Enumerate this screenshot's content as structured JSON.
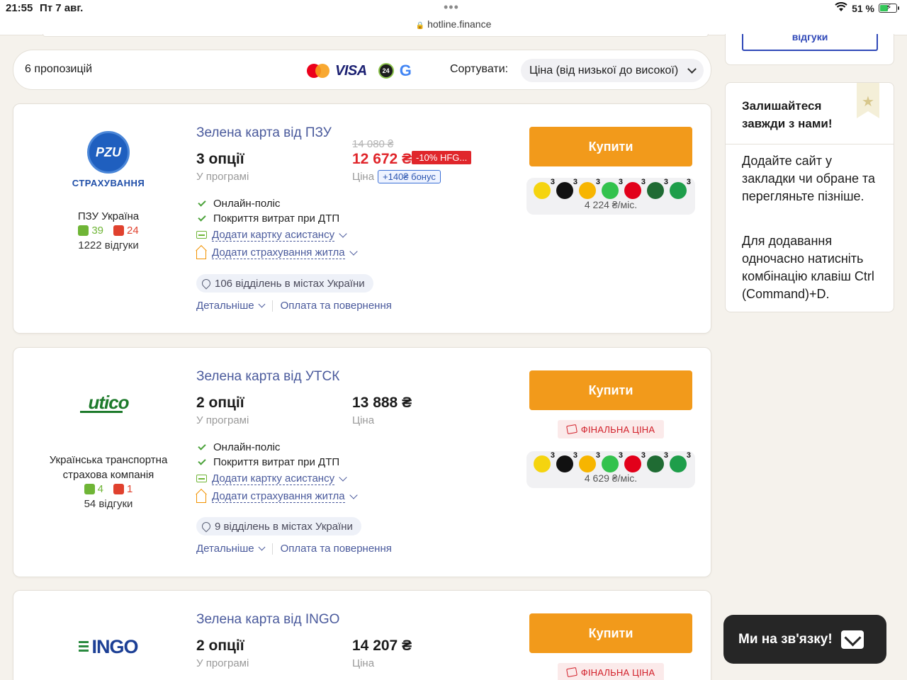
{
  "status_bar": {
    "time": "21:55",
    "date": "Пт 7 авг.",
    "url": "hotline.finance",
    "battery": "51 %"
  },
  "sort_bar": {
    "offers_count": "6 пропозицій",
    "payment_icons": [
      "mastercard-icon",
      "visa-icon",
      "apple-pay-icon",
      "privat24-icon",
      "google-pay-icon"
    ],
    "visa_text": "VISA",
    "p24_text": "24",
    "google_text": "G",
    "sort_label": "Сортувати:",
    "sort_value": "Ціна (від низької до високої)"
  },
  "offers": [
    {
      "title": "Зелена карта від ПЗУ",
      "logo_text": "PZU",
      "logo_caption": "СТРАХУВАННЯ",
      "company": "ПЗУ Україна",
      "likes": "39",
      "dislikes": "24",
      "reviews": "1222 відгуки",
      "options": "3 опції",
      "options_sub": "У програмі",
      "price_old": "14 080 ₴",
      "price": "12 672 ₴",
      "discount": "-10% HFG...",
      "price_sub": "Ціна",
      "bonus": "+140₴ бонус",
      "features": [
        "Онлайн-поліс",
        "Покриття витрат при ДТП"
      ],
      "addons": [
        "Додати картку асистансу",
        "Додати страхування житла"
      ],
      "branches": "106 відділень в містах України",
      "more": "Детальніше",
      "payment_link": "Оплата та повернення",
      "buy": "Купити",
      "installment": "4 224 ₴/міс."
    },
    {
      "title": "Зелена карта від УТСК",
      "logo_text": "utico",
      "company": "Українська транспортна страхова компанія",
      "likes": "4",
      "dislikes": "1",
      "reviews": "54 відгуки",
      "options": "2 опції",
      "options_sub": "У програмі",
      "price": "13 888 ₴",
      "price_sub": "Ціна",
      "features": [
        "Онлайн-поліс",
        "Покриття витрат при ДТП"
      ],
      "addons": [
        "Додати картку асистансу",
        "Додати страхування житла"
      ],
      "branches": "9 відділень в містах України",
      "more": "Детальніше",
      "payment_link": "Оплата та повернення",
      "buy": "Купити",
      "final_price": "ФІНАЛЬНА ЦІНА",
      "installment": "4 629 ₴/міс."
    },
    {
      "title": "Зелена карта від INGO",
      "logo_text": "INGO",
      "options": "2 опції",
      "options_sub": "У програмі",
      "price": "14 207 ₴",
      "price_sub": "Ціна",
      "buy": "Купити",
      "final_price": "ФІНАЛЬНА ЦІНА"
    }
  ],
  "installment_banks": [
    {
      "name": "bank-yellow-icon",
      "count": "3",
      "color": "#f5d40f"
    },
    {
      "name": "bank-paw-icon",
      "count": "3",
      "color": "#111111"
    },
    {
      "name": "bank-orange-icon",
      "count": "3",
      "color": "#f7b500"
    },
    {
      "name": "bank-a-icon",
      "count": "3",
      "color": "#33c24d"
    },
    {
      "name": "bank-pumb-icon",
      "count": "3",
      "color": "#e2001a"
    },
    {
      "name": "bank-green-icon",
      "count": "3",
      "color": "#1f6b33"
    },
    {
      "name": "bank-oschad-icon",
      "count": "3",
      "color": "#1e9e4a"
    }
  ],
  "sidebar": {
    "reviews_button": "відгуки",
    "stay_title": "Залишайтеся завжди з нами!",
    "stay_p1": "Додайте сайт у закладки чи обране та перегляньте пізніше.",
    "stay_p2": "Для додавання одночасно натисніть комбінацію клавіш Ctrl (Command)+D."
  },
  "chat": {
    "label": "Ми на зв'язку!"
  }
}
